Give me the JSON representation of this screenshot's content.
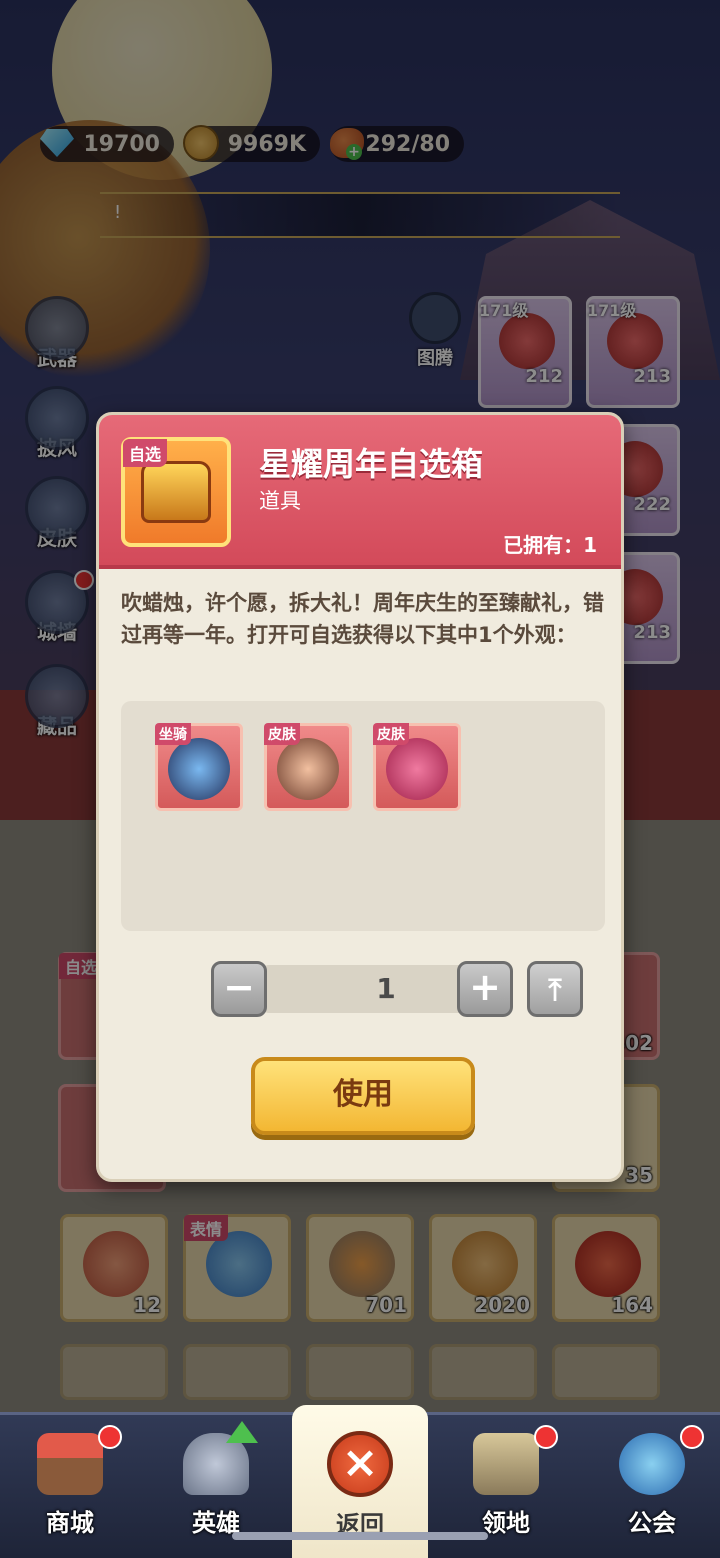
{
  "resources": {
    "gems": "19700",
    "gold": "9969K",
    "stamina": "292/80",
    "gem_icon": "diamond-icon",
    "gold_icon": "coin-icon",
    "stamina_icon": "meat-icon"
  },
  "banner": {
    "mark": "!"
  },
  "side_menu": [
    {
      "label": "武器",
      "icon": "weapon-icon",
      "badge": false
    },
    {
      "label": "披风",
      "icon": "cape-icon",
      "badge": false
    },
    {
      "label": "皮肤",
      "icon": "skin-icon",
      "badge": false
    },
    {
      "label": "城墙",
      "icon": "castle-wall-icon",
      "badge": true
    },
    {
      "label": "藏品",
      "icon": "collection-icon",
      "badge": false
    }
  ],
  "totem": {
    "label": "图腾"
  },
  "hero_cards": [
    {
      "level": "171级",
      "count": "212"
    },
    {
      "level": "171级",
      "count": "213"
    },
    {
      "level": "",
      "count": "222"
    },
    {
      "level": "",
      "count": "213"
    }
  ],
  "modal": {
    "tag": "自选",
    "title": "星耀周年自选箱",
    "subtitle": "道具",
    "owned": "已拥有：1",
    "description": "吹蜡烛，许个愿，拆大礼！周年庆生的至臻献礼，错过再等一年。打开可自选获得以下其中1个外观：",
    "options": [
      {
        "tag": "坐骑",
        "icon": "dragon-mount-icon"
      },
      {
        "tag": "皮肤",
        "icon": "masked-hero-skin-icon"
      },
      {
        "tag": "皮肤",
        "icon": "crimson-dagger-skin-icon"
      }
    ],
    "quantity": "1",
    "use_label": "使用"
  },
  "inventory": {
    "partial_row": [
      {
        "tag": "自选",
        "count": ""
      },
      {
        "count": "402"
      },
      {
        "count": "35"
      }
    ],
    "row": [
      {
        "count": "12",
        "tag": ""
      },
      {
        "count": "",
        "tag": "表情"
      },
      {
        "count": "701",
        "tag": ""
      },
      {
        "count": "2020",
        "tag": ""
      },
      {
        "count": "164",
        "tag": ""
      }
    ]
  },
  "bottom_nav": [
    {
      "label": "商城",
      "icon": "shop-icon",
      "badge": true
    },
    {
      "label": "英雄",
      "icon": "hero-helmet-icon",
      "badge": false
    },
    {
      "label": "返回",
      "icon": "close-icon",
      "badge": false
    },
    {
      "label": "领地",
      "icon": "territory-tower-icon",
      "badge": true
    },
    {
      "label": "公会",
      "icon": "guild-planet-icon",
      "badge": true
    }
  ],
  "colors": {
    "modal_header": "#d34a5a",
    "use_button": "#f3b733",
    "badge_red": "#e33333"
  }
}
